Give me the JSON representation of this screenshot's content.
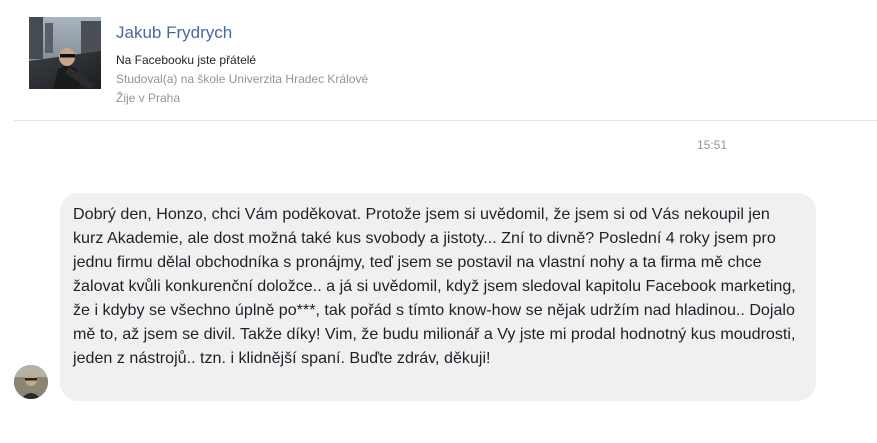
{
  "profile": {
    "name": "Jakub Frydrych",
    "relationship": "Na Facebooku jste přátelé",
    "education": "Studoval(a) na škole Univerzita Hradec Králové",
    "location": "Žije v Praha"
  },
  "conversation": {
    "timestamp": "15:51",
    "messages": [
      {
        "text": "Dobrý den, Honzo, chci Vám poděkovat. Protože jsem si uvědomil, že jsem si od Vás nekoupil jen kurz Akademie, ale dost možná také kus svobody a jistoty... Zní to divně? Poslední 4 roky jsem pro jednu firmu dělal obchodníka s pronájmy, teď jsem se postavil na vlastní nohy a ta firma mě chce žalovat kvůli konkurenční doložce.. a já si uvědomil, když jsem sledoval kapitolu Facebook marketing, že i kdyby se všechno úplně po***, tak pořád s tímto know-how se nějak udržím nad hladinou.. Dojalo mě to, až jsem se divil. Takže díky! Vim, že budu milionář a Vy jste mi prodal hodnotný kus moudrosti, jeden z nástrojů.. tzn. i klidnější spaní. Buďte zdráv, děkuji!"
      }
    ]
  },
  "icons": {
    "profile_photo": "profile-photo",
    "sender_avatar": "avatar"
  },
  "colors": {
    "name_link": "#4b67a1",
    "secondary_text": "#90949c",
    "primary_text": "#1d2129",
    "bubble_background": "#f1f0f0",
    "divider": "#e5e6e9"
  }
}
